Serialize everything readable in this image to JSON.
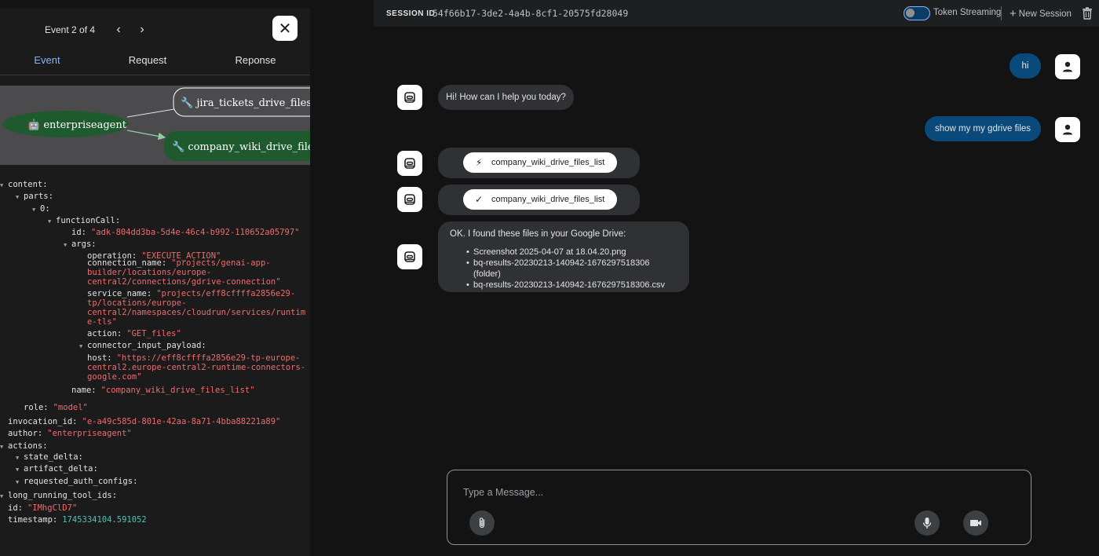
{
  "event_panel": {
    "counter": "Event 2 of 4",
    "prev_icon": "chevron-left-icon",
    "next_icon": "chevron-right-icon",
    "close_icon": "close-icon",
    "tabs": [
      {
        "label": "Event"
      },
      {
        "label": "Request"
      },
      {
        "label": "Reponse"
      }
    ],
    "graph": {
      "agent_node": "🤖 enterpriseagent",
      "tool_nodes": [
        "🔧 jira_tickets_drive_files_li",
        "🔧 company_wiki_drive_files_"
      ]
    },
    "json_lines": [
      {
        "k": "content:"
      },
      {
        "k": "parts:"
      },
      {
        "k": "0:"
      },
      {
        "k": "functionCall:"
      },
      {
        "k": "id:",
        "v": "\"adk-804dd3ba-5d4e-46c4-b992-110652a05797\""
      },
      {
        "k": "args:"
      },
      {
        "k": "operation:",
        "v": "\"EXECUTE_ACTION\""
      },
      {
        "k": "connection_name:",
        "v": "\"projects/genai-app-"
      },
      {
        "v": "builder/locations/europe-"
      },
      {
        "v": "central2/connections/gdrive-connection\""
      },
      {
        "k": "service_name:",
        "v": "\"projects/eff8cffffa2856e29-"
      },
      {
        "v": "tp/locations/europe-"
      },
      {
        "v": "central2/namespaces/cloudrun/services/runtim"
      },
      {
        "v": "e-tls\""
      },
      {
        "k": "action:",
        "v": "\"GET_files\""
      },
      {
        "k": "connector_input_payload:"
      },
      {
        "k": "host:",
        "v": "\"https://eff8cffffa2856e29-tp-europe-"
      },
      {
        "v": "central2.europe-central2-runtime-connectors-"
      },
      {
        "v": "google.com\""
      },
      {
        "k": "name:",
        "v": "\"company_wiki_drive_files_list\""
      },
      {
        "k": "role:",
        "v": "\"model\""
      },
      {
        "k": "invocation_id:",
        "v": "\"e-a49c585d-801e-42aa-8a71-4bba88221a89\""
      },
      {
        "k": "author:",
        "v": "\"enterpriseagent\""
      },
      {
        "k": "actions:"
      },
      {
        "k": "state_delta:"
      },
      {
        "k": "artifact_delta:"
      },
      {
        "k": "requested_auth_configs:"
      },
      {
        "k": "long_running_tool_ids:"
      },
      {
        "k": "id:",
        "v": "\"IMhgClD7\""
      },
      {
        "k": "timestamp:",
        "n": "1745334104.591052"
      }
    ]
  },
  "session": {
    "label": "SESSION ID",
    "id": "54f66b17-3de2-4a4b-8cf1-20575fd28049",
    "token_streaming_label": "Token Streaming",
    "token_streaming_on": false,
    "new_session_label": "New Session",
    "delete_icon": "trash-icon"
  },
  "chat": {
    "messages": [
      {
        "role": "user",
        "text": "hi"
      },
      {
        "role": "bot",
        "text": "Hi! How can I help you today?"
      },
      {
        "role": "user",
        "text": "show my my gdrive files"
      },
      {
        "role": "bot",
        "type": "function_call",
        "icon": "bolt-icon",
        "text": "company_wiki_drive_files_list"
      },
      {
        "role": "bot",
        "type": "function_response",
        "icon": "check-icon",
        "text": "company_wiki_drive_files_list"
      },
      {
        "role": "bot",
        "text": "OK. I found these files in your Google Drive:",
        "items": [
          "Screenshot 2025-04-07 at 18.04.20.png",
          "bq-results-20230213-140942-1676297518306 (folder)",
          "bq-results-20230213-140942-1676297518306.csv"
        ]
      }
    ],
    "composer": {
      "placeholder": "Type a Message...",
      "attach_icon": "paperclip-icon",
      "mic_icon": "microphone-icon",
      "video_icon": "video-camera-icon"
    }
  },
  "colors": {
    "user_bubble": "#0a4a7a",
    "bot_bubble": "#303134",
    "graph_agent_node": "#1e5a2e",
    "json_string": "#ef6b6b",
    "json_number": "#4fc3b0",
    "active_tab": "#8ab4f8"
  }
}
